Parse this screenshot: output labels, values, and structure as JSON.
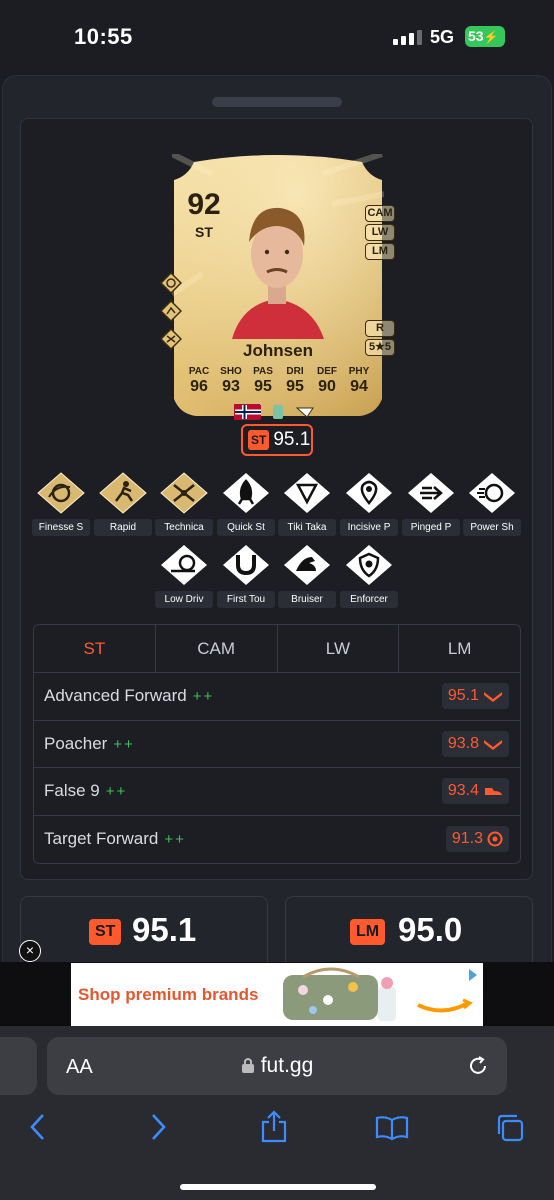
{
  "status": {
    "time": "10:55",
    "network": "5G",
    "battery": "53"
  },
  "card": {
    "rating": "92",
    "position": "ST",
    "alt_positions": [
      "CAM",
      "LW",
      "LM",
      "R",
      "5★5"
    ],
    "name": "Johnsen",
    "stats": [
      {
        "key": "PAC",
        "value": "96"
      },
      {
        "key": "SHO",
        "value": "93"
      },
      {
        "key": "PAS",
        "value": "95"
      },
      {
        "key": "DRI",
        "value": "95"
      },
      {
        "key": "DEF",
        "value": "90"
      },
      {
        "key": "PHY",
        "value": "94"
      }
    ]
  },
  "overall": {
    "position": "ST",
    "value": "95.1"
  },
  "playstyles": [
    {
      "label": "Finesse S",
      "icon": "finesse-shot-icon",
      "plus": true
    },
    {
      "label": "Rapid",
      "icon": "rapid-icon",
      "plus": true
    },
    {
      "label": "Technica",
      "icon": "technical-icon",
      "plus": true
    },
    {
      "label": "Quick St",
      "icon": "quick-step-icon",
      "plus": false
    },
    {
      "label": "Tiki Taka",
      "icon": "tiki-taka-icon",
      "plus": false
    },
    {
      "label": "Incisive P",
      "icon": "incisive-pass-icon",
      "plus": false
    },
    {
      "label": "Pinged P",
      "icon": "pinged-pass-icon",
      "plus": false
    },
    {
      "label": "Power Sh",
      "icon": "power-shot-icon",
      "plus": false
    },
    {
      "label": "Low Driv",
      "icon": "low-driven-shot-icon",
      "plus": false
    },
    {
      "label": "First Tou",
      "icon": "first-touch-icon",
      "plus": false
    },
    {
      "label": "Bruiser",
      "icon": "bruiser-icon",
      "plus": false
    },
    {
      "label": "Enforcer",
      "icon": "enforcer-icon",
      "plus": false
    }
  ],
  "tabs": [
    "ST",
    "CAM",
    "LW",
    "LM"
  ],
  "roles": [
    {
      "name": "Advanced Forward",
      "plus": "++",
      "score": "95.1",
      "icon": "chevron-icon"
    },
    {
      "name": "Poacher",
      "plus": "++",
      "score": "93.8",
      "icon": "chevron-icon"
    },
    {
      "name": "False 9",
      "plus": "++",
      "score": "93.4",
      "icon": "boot-icon"
    },
    {
      "name": "Target Forward",
      "plus": "++",
      "score": "91.3",
      "icon": "target-icon"
    }
  ],
  "best": [
    {
      "position": "ST",
      "value": "95.1"
    },
    {
      "position": "LM",
      "value": "95.0"
    }
  ],
  "ad": {
    "text": "Shop premium brands"
  },
  "browser": {
    "aa": "AA",
    "domain": "fut.gg"
  },
  "colors": {
    "accent": "#ff5a2e",
    "plus": "#3fbf5a",
    "gold": "#e3c27a"
  }
}
